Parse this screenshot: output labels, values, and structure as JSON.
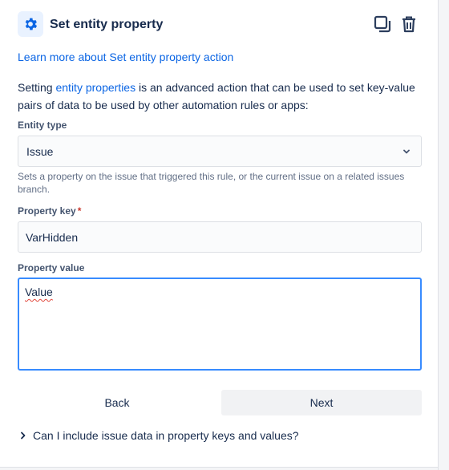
{
  "header": {
    "icon": "gear-icon",
    "title": "Set entity property",
    "copy_icon": "copy-icon",
    "delete_icon": "trash-icon"
  },
  "learn_more": "Learn more about Set entity property action",
  "description": {
    "prefix": "Setting ",
    "link": "entity properties",
    "suffix": " is an advanced action that can be used to set key-value pairs of data to be used by other automation rules or apps:"
  },
  "entity_type": {
    "label": "Entity type",
    "value": "Issue",
    "help": "Sets a property on the issue that triggered this rule, or the current issue on a related issues branch."
  },
  "property_key": {
    "label": "Property key",
    "required_mark": "*",
    "value": "VarHidden"
  },
  "property_value": {
    "label": "Property value",
    "value": "Value"
  },
  "buttons": {
    "back": "Back",
    "next": "Next"
  },
  "faq": {
    "text": "Can I include issue data in property keys and values?"
  },
  "colors": {
    "link": "#0c66e4",
    "focus": "#388bff",
    "required": "#c9372c"
  }
}
